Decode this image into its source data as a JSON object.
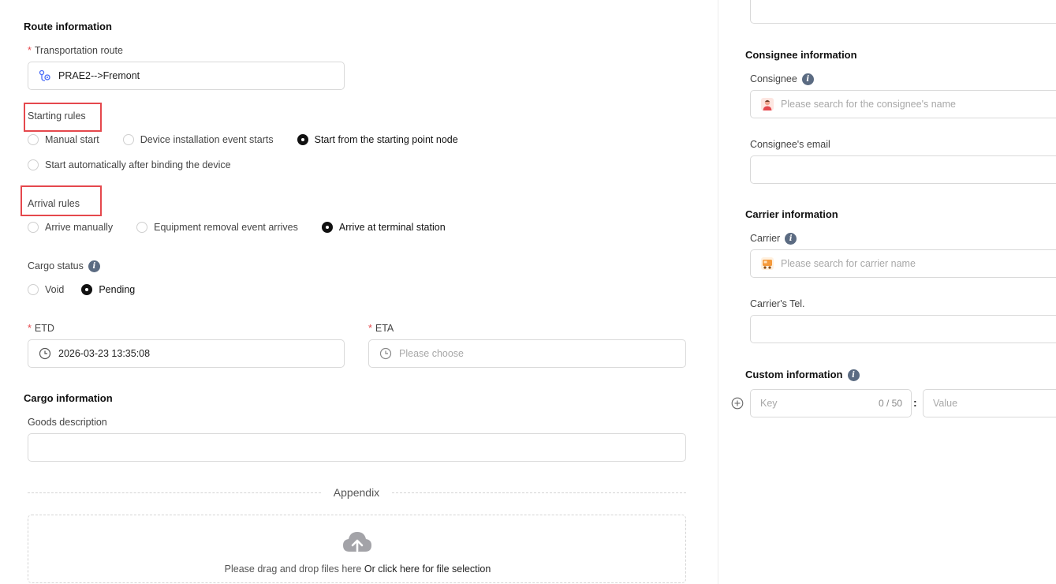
{
  "left": {
    "route_section_title": "Route information",
    "transportation_route_label": "Transportation route",
    "transportation_route_value": "PRAE2-->Fremont",
    "starting_rules_label": "Starting rules",
    "starting_rules_options": [
      "Manual start",
      "Device installation event starts",
      "Start from the starting point node",
      "Start automatically after binding the device"
    ],
    "starting_rules_selected": "Start from the starting point node",
    "arrival_rules_label": "Arrival rules",
    "arrival_rules_options": [
      "Arrive manually",
      "Equipment removal event arrives",
      "Arrive at terminal station"
    ],
    "arrival_rules_selected": "Arrive at terminal station",
    "cargo_status_label": "Cargo status",
    "cargo_status_options": [
      "Void",
      "Pending"
    ],
    "cargo_status_selected": "Pending",
    "etd_label": "ETD",
    "etd_value": "2026-03-23 13:35:08",
    "eta_label": "ETA",
    "eta_placeholder": "Please choose",
    "cargo_section_title": "Cargo information",
    "goods_description_label": "Goods description",
    "goods_description_value": "",
    "appendix_label": "Appendix",
    "upload_text_prefix": "Please drag and drop files here",
    "upload_text_link": "Or click here for file selection",
    "required_mark": "*",
    "info_glyph": "i"
  },
  "right": {
    "consignee_section_title": "Consignee information",
    "consignee_label": "Consignee",
    "consignee_placeholder": "Please search for the consignee's name",
    "consignee_email_label": "Consignee's email",
    "consignee_email_value": "",
    "carrier_section_title": "Carrier information",
    "carrier_label": "Carrier",
    "carrier_placeholder": "Please search for carrier name",
    "carrier_tel_label": "Carrier's Tel.",
    "carrier_tel_value": "",
    "custom_section_title": "Custom information",
    "key_placeholder": "Key",
    "key_counter": "0 / 50",
    "separator": ":",
    "value_placeholder": "Value"
  },
  "colors": {
    "highlight": "#e5484d",
    "required": "#e5484d",
    "info_icon": "#5b6b82",
    "radio_checked": "#111111"
  }
}
